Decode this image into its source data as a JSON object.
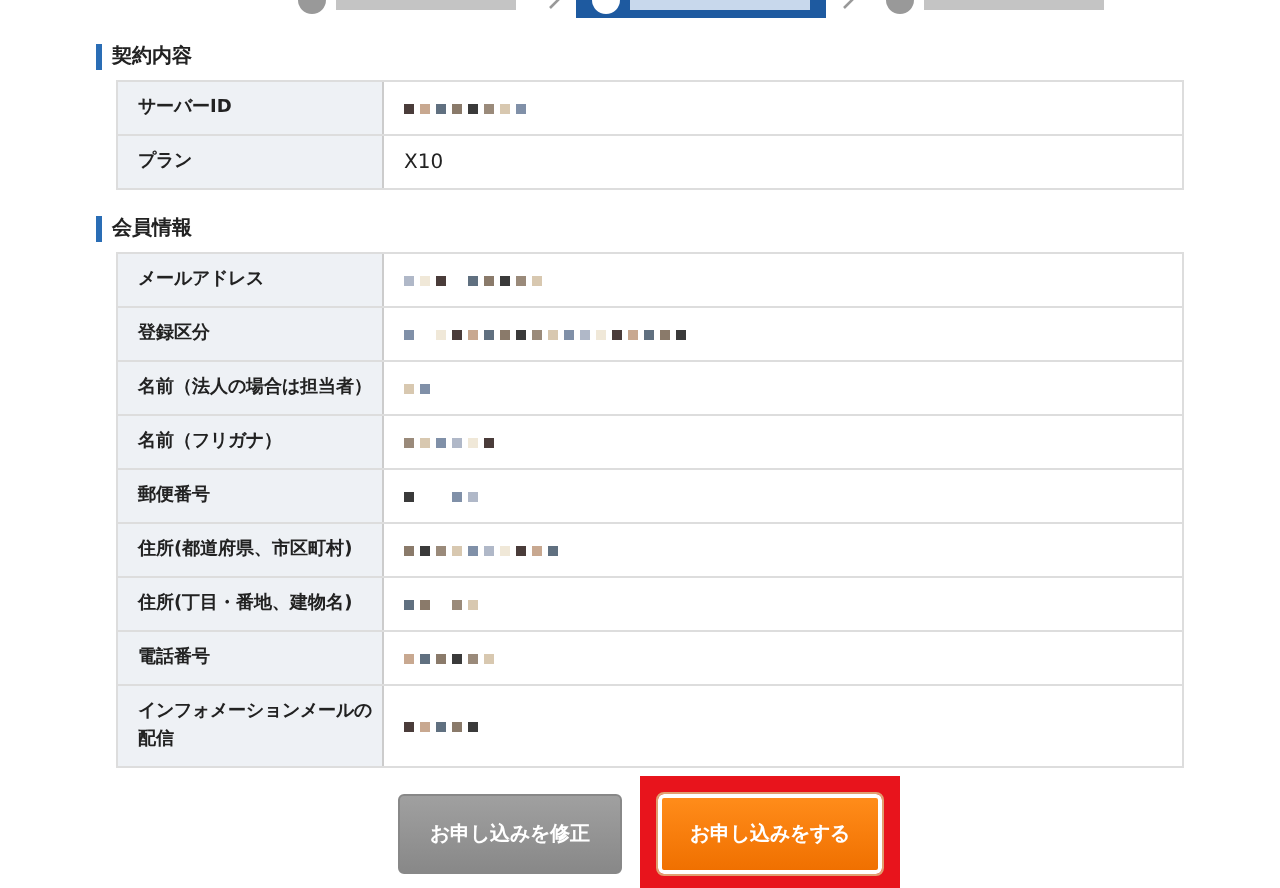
{
  "steps": [
    {
      "selected": false
    },
    {
      "selected": true
    },
    {
      "selected": false
    }
  ],
  "sections": [
    {
      "title": "契約内容",
      "rows": [
        {
          "label": "サーバーID",
          "redacted": true
        },
        {
          "label": "プラン",
          "value": "X10",
          "redacted": false
        }
      ]
    },
    {
      "title": "会員情報",
      "rows": [
        {
          "label": "メールアドレス",
          "redacted": true
        },
        {
          "label": "登録区分",
          "redacted": true
        },
        {
          "label": "名前（法人の場合は担当者）",
          "redacted": true
        },
        {
          "label": "名前（フリガナ）",
          "redacted": true
        },
        {
          "label": "郵便番号",
          "redacted": true
        },
        {
          "label": "住所(都道府県、市区町村)",
          "redacted": true
        },
        {
          "label": "住所(丁目・番地、建物名)",
          "redacted": true
        },
        {
          "label": "電話番号",
          "redacted": true
        },
        {
          "label": "インフォメーションメールの配信",
          "redacted": true
        }
      ]
    }
  ],
  "buttons": [
    {
      "label": "お申し込みを修正",
      "kind": "secondary",
      "highlighted": false
    },
    {
      "label": "お申し込みをする",
      "kind": "primary",
      "highlighted": true
    }
  ]
}
